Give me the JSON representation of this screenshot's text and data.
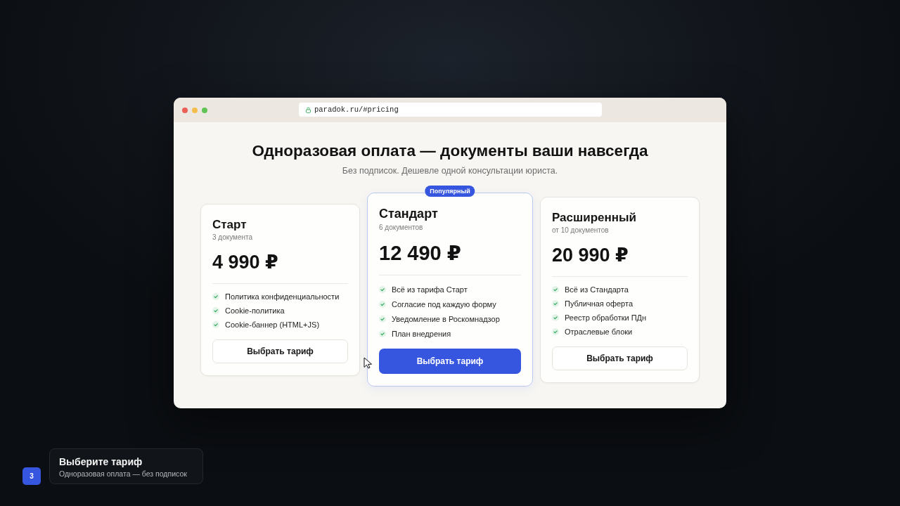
{
  "browser": {
    "url": "paradok.ru/#pricing"
  },
  "hero": {
    "title": "Одноразовая оплата — документы ваши навсегда",
    "subtitle": "Без подписок. Дешевле одной консультации юриста."
  },
  "plans": [
    {
      "name": "Старт",
      "documents": "3 документа",
      "price": "4 990 ₽",
      "featured": false,
      "features": [
        "Политика конфиденциальности",
        "Cookie-политика",
        "Cookie-баннер (HTML+JS)"
      ],
      "button": "Выбрать тариф"
    },
    {
      "name": "Стандарт",
      "documents": "6 документов",
      "price": "12 490 ₽",
      "featured": true,
      "badge": "Популярный",
      "features": [
        "Всё из тарифа Старт",
        "Согласие под каждую форму",
        "Уведомление в Роскомнадзор",
        "План внедрения"
      ],
      "button": "Выбрать тариф"
    },
    {
      "name": "Расширенный",
      "documents": "от 10 документов",
      "price": "20 990 ₽",
      "featured": false,
      "features": [
        "Всё из Стандарта",
        "Публичная оферта",
        "Реестр обработки ПДн",
        "Отраслевые блоки"
      ],
      "button": "Выбрать тариф"
    }
  ],
  "step": {
    "number": "3",
    "title": "Выберите тариф",
    "subtitle": "Одноразовая оплата — без подписок"
  }
}
